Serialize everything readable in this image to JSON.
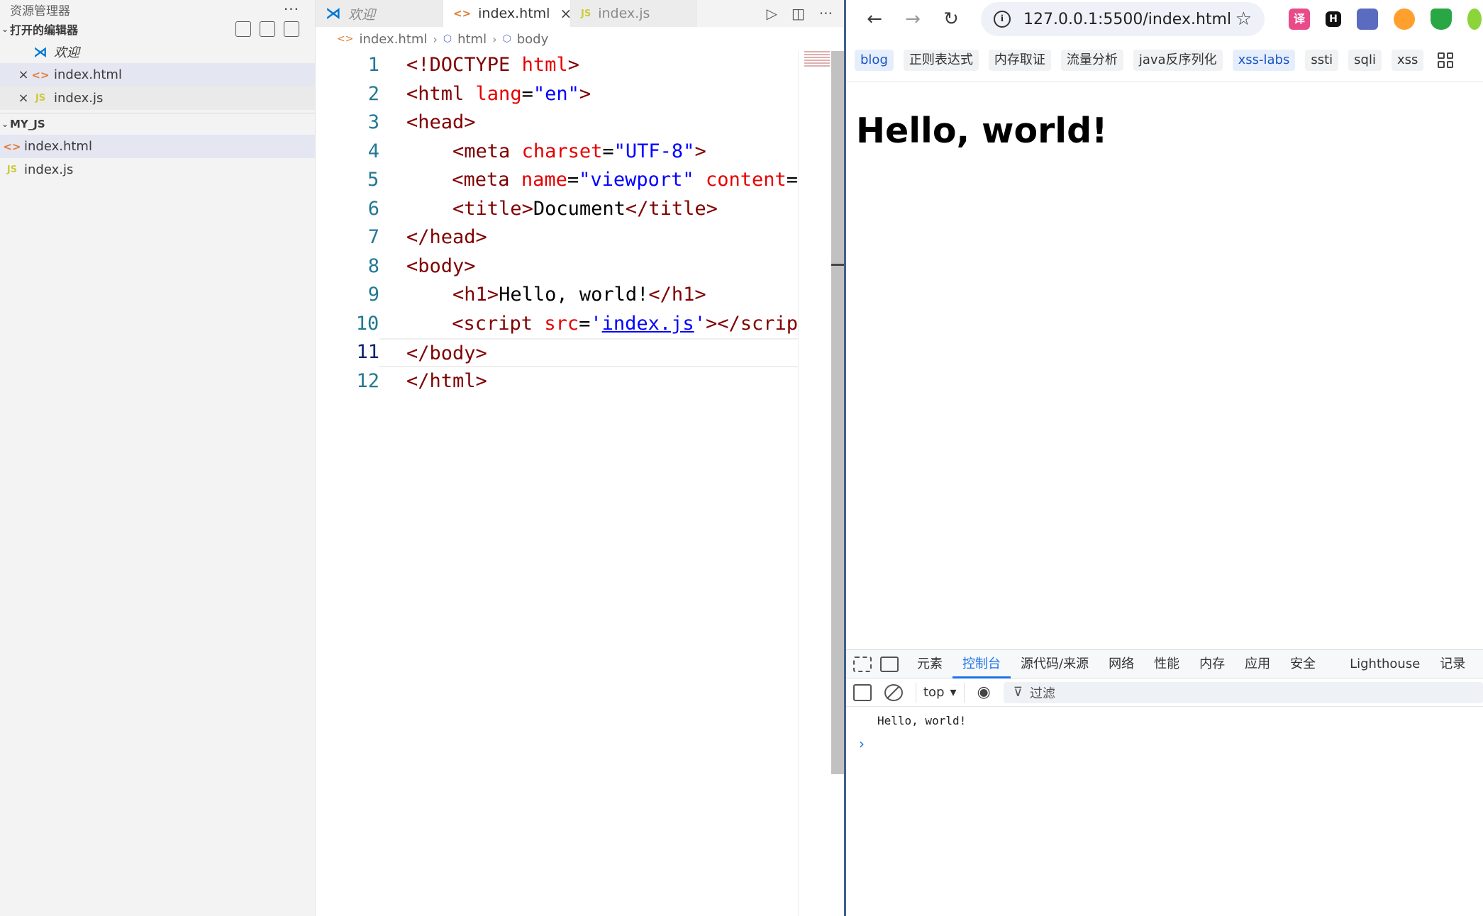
{
  "explorer": {
    "title": "资源管理器",
    "more": "···",
    "open_editors": {
      "title": "打开的编辑器",
      "items": [
        {
          "label": "欢迎",
          "icon": "vscode-icon",
          "italic": true
        },
        {
          "label": "index.html",
          "icon": "html-icon"
        },
        {
          "label": "index.js",
          "icon": "js-icon"
        }
      ]
    },
    "folder": {
      "title": "MY_JS",
      "items": [
        {
          "label": "index.html",
          "icon": "html-icon"
        },
        {
          "label": "index.js",
          "icon": "js-icon"
        }
      ]
    }
  },
  "editor": {
    "tabs": [
      {
        "label": "欢迎",
        "icon": "vscode-icon"
      },
      {
        "label": "index.html",
        "icon": "html-icon",
        "active": true
      },
      {
        "label": "index.js",
        "icon": "js-icon"
      }
    ],
    "breadcrumb": [
      "index.html",
      "html",
      "body"
    ],
    "current_line": 11,
    "code_lines": [
      "1",
      "2",
      "3",
      "4",
      "5",
      "6",
      "7",
      "8",
      "9",
      "10",
      "11",
      "12"
    ]
  },
  "browser": {
    "url": "127.0.0.1:5500/index.html",
    "extensions": [
      "译",
      "H",
      "",
      "",
      "",
      ""
    ],
    "bookmarks": [
      "blog",
      "正则表达式",
      "内存取证",
      "流量分析",
      "java反序列化",
      "xss-labs",
      "ssti",
      "sqli",
      "xss"
    ],
    "page_heading": "Hello, world!",
    "devtools": {
      "tabs": [
        "元素",
        "控制台",
        "源代码/来源",
        "网络",
        "性能",
        "内存",
        "应用",
        "安全",
        "Lighthouse",
        "记录"
      ],
      "active_tab": "控制台",
      "context": "top",
      "filter_label": "过滤",
      "console_output": "Hello, world!",
      "prompt": "›"
    }
  },
  "colors": {
    "tag": "#800000",
    "attr": "#e50000",
    "string": "#0000ff",
    "line_number": "#237893",
    "devtools_active": "#1a73e8"
  }
}
